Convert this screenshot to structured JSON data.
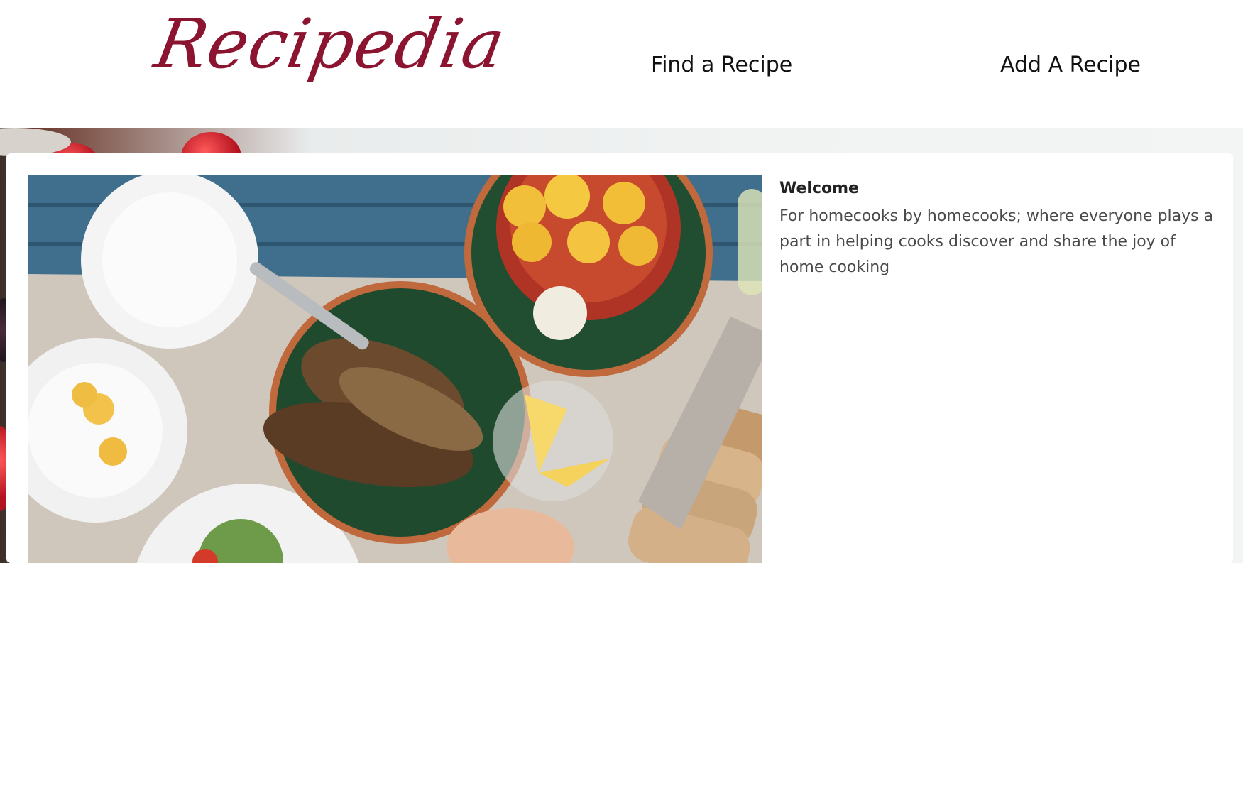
{
  "header": {
    "logo_text": "Recipedia",
    "nav": {
      "find_label": "Find a Recipe",
      "add_label": "Add A Recipe"
    }
  },
  "hero": {
    "image_icon": "food-table-photo"
  },
  "welcome": {
    "title": "Welcome",
    "text": "For homecooks by homecooks; where everyone plays a part in helping cooks discover and share the joy of home cooking"
  },
  "colors": {
    "brand": "#8b1430",
    "nav_text": "#111111",
    "body_text": "#4a4a4a"
  }
}
